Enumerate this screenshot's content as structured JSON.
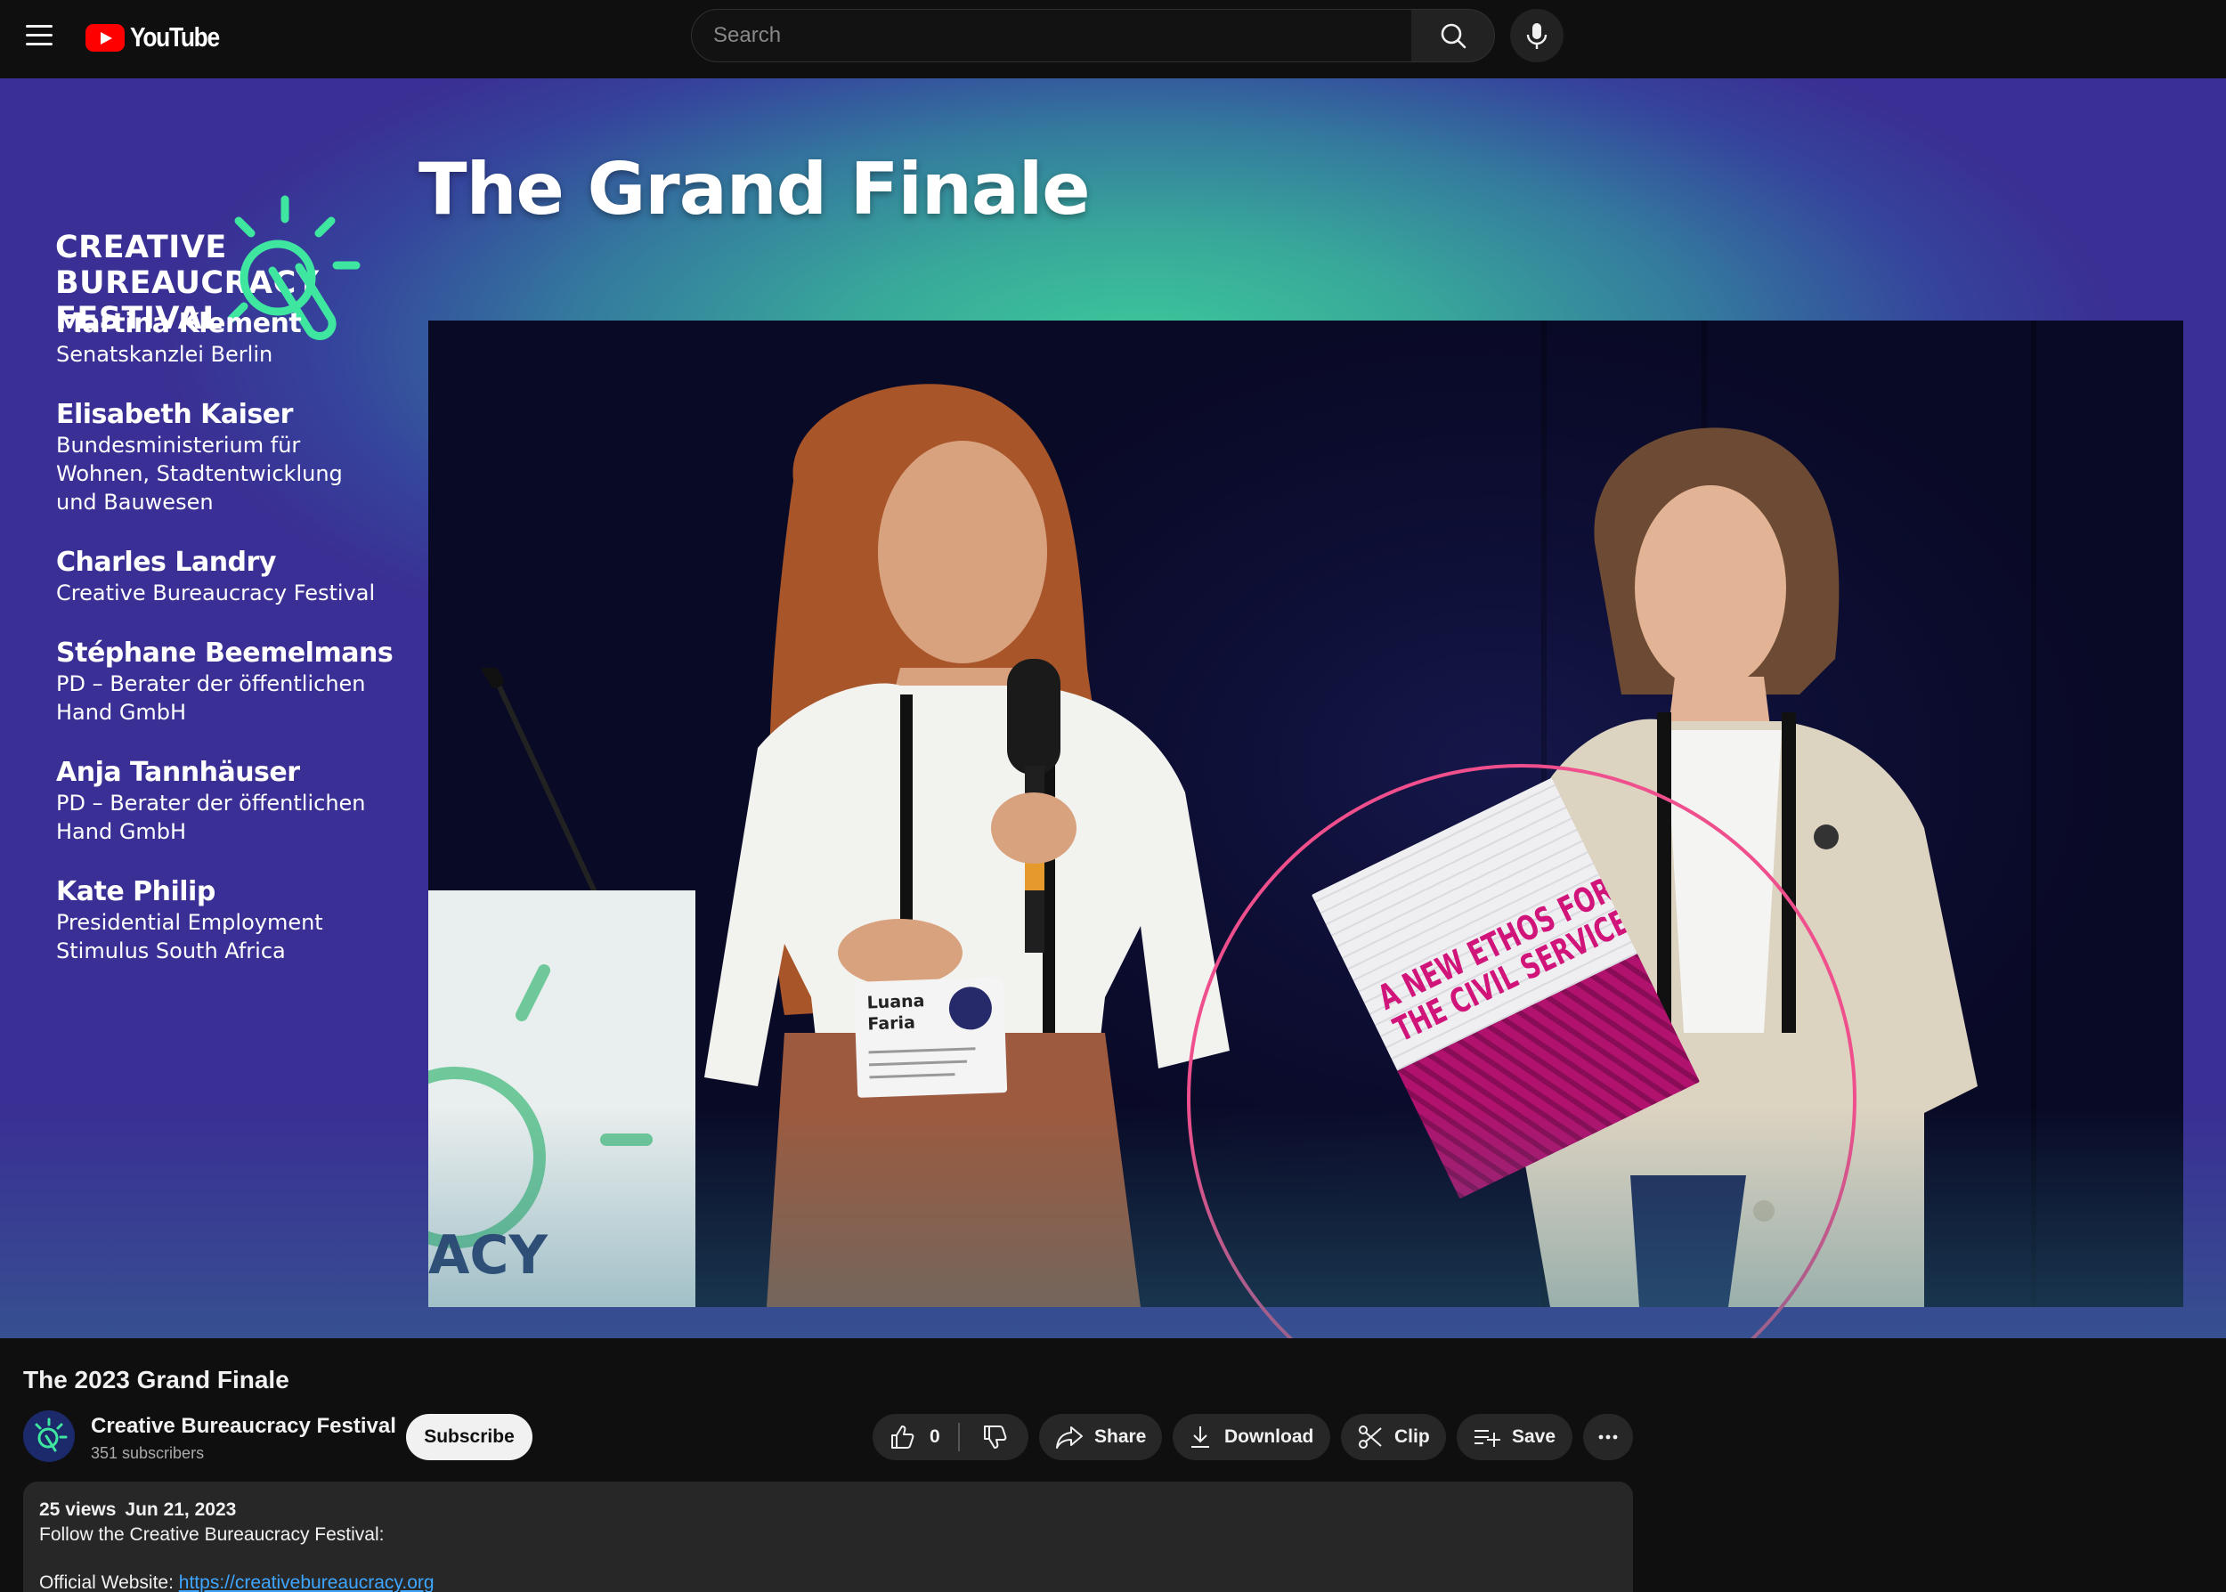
{
  "header": {
    "logo_text": "YouTube",
    "search_placeholder": "Search"
  },
  "video_frame": {
    "headline": "The Grand Finale",
    "festival_logo": [
      "CREATIVE",
      "BUREAUCRACY",
      "FESTIVAL"
    ],
    "speakers": [
      {
        "name": "Martina Klement",
        "org": [
          "Senatskanzlei Berlin"
        ]
      },
      {
        "name": "Elisabeth Kaiser",
        "org": [
          "Bundesministerium für",
          "Wohnen, Stadtentwicklung",
          "und Bauwesen"
        ]
      },
      {
        "name": "Charles Landry",
        "org": [
          "Creative Bureaucracy Festival"
        ]
      },
      {
        "name": "Stéphane Beemelmans",
        "org": [
          "PD – Berater der öffentlichen",
          "Hand GmbH"
        ]
      },
      {
        "name": "Anja Tannhäuser",
        "org": [
          "PD – Berater der öffentlichen",
          "Hand GmbH"
        ]
      },
      {
        "name": "Kate Philip",
        "org": [
          "Presidential Employment",
          "Stimulus South Africa"
        ]
      }
    ],
    "badge_name": [
      "Luana",
      "Faria"
    ],
    "booklet_title": [
      "A NEW ETHOS FOR",
      "THE CIVIL SERVICE"
    ],
    "stage_logo_partial": "ACY",
    "highlight_color": "#ef4f8c"
  },
  "video": {
    "title": "The 2023 Grand Finale",
    "channel_name": "Creative Bureaucracy Festival",
    "subscribers": "351 subscribers",
    "subscribe_label": "Subscribe",
    "like_count": "0",
    "share_label": "Share",
    "download_label": "Download",
    "clip_label": "Clip",
    "save_label": "Save"
  },
  "description": {
    "views": "25 views",
    "date": "Jun 21, 2023",
    "line1": "Follow the Creative Bureaucracy Festival:",
    "website_label": "Official Website: ",
    "website_url": "https://creativebureaucracy.org"
  },
  "colors": {
    "page_bg": "#0f0f0f",
    "pill_bg": "#272727",
    "brand_red": "#ff0000",
    "link": "#3ea6ff",
    "festival_green": "#3ee6a0"
  }
}
